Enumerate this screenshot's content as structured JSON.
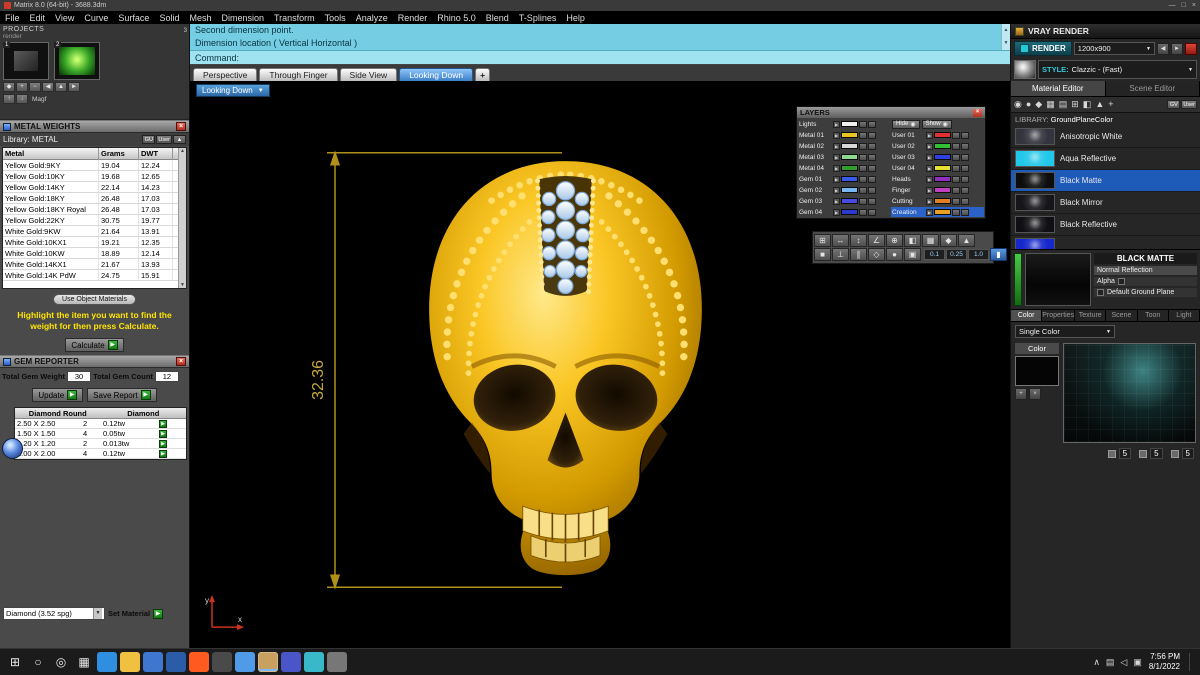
{
  "window": {
    "title": "Matrix 8.0 (64-bit) - 3688.3dm",
    "controls": {
      "minimize": "—",
      "maximize": "□",
      "close": "×"
    },
    "menus": [
      "File",
      "Edit",
      "View",
      "Curve",
      "Surface",
      "Solid",
      "Mesh",
      "Dimension",
      "Transform",
      "Tools",
      "Analyze",
      "Render",
      "Rhino 5.0",
      "Blend",
      "T-Splines",
      "Help"
    ]
  },
  "projects": {
    "label": "PROJECTS",
    "sublabel": "render",
    "thumbs": [
      {
        "num": "1"
      },
      {
        "num": "2"
      }
    ],
    "side_num": "3",
    "toolbar1": [
      "◆",
      "+",
      "−",
      "◀",
      "▲",
      "►"
    ],
    "toolbar2": [
      "↑",
      "↓"
    ],
    "mag_label": "Magf"
  },
  "metal_weights": {
    "title": "METAL WEIGHTS",
    "library_label": "Library:  METAL",
    "lib_buttons": [
      "GU",
      "User",
      "▲"
    ],
    "columns": [
      "Metal",
      "Grams",
      "DWT"
    ],
    "rows": [
      [
        "Yellow Gold:9KY",
        "19.04",
        "12.24"
      ],
      [
        "Yellow Gold:10KY",
        "19.68",
        "12.65"
      ],
      [
        "Yellow Gold:14KY",
        "22.14",
        "14.23"
      ],
      [
        "Yellow Gold:18KY",
        "26.48",
        "17.03"
      ],
      [
        "Yellow Gold:18KY Royal",
        "26.48",
        "17.03"
      ],
      [
        "Yellow Gold:22KY",
        "30.75",
        "19.77"
      ],
      [
        "White Gold:9KW",
        "21.64",
        "13.91"
      ],
      [
        "White Gold:10KX1",
        "19.21",
        "12.35"
      ],
      [
        "White Gold:10KW",
        "18.89",
        "12.14"
      ],
      [
        "White Gold:14KX1",
        "21.67",
        "13.93"
      ],
      [
        "White Gold:14K PdW",
        "24.75",
        "15.91"
      ]
    ],
    "use_object_label": "Use Object Materials",
    "hint": "Highlight the item you want to find the weight for then press Calculate.",
    "calculate_label": "Calculate"
  },
  "gem_reporter": {
    "title": "GEM REPORTER",
    "total_weight_label": "Total Gem Weight",
    "total_weight": "30",
    "total_count_label": "Total Gem Count",
    "total_count": "12",
    "update_label": "Update",
    "save_label": "Save Report",
    "columns": [
      "Diamond Round",
      "Diamond"
    ],
    "rows": [
      [
        "2.50 X 2.50",
        "2",
        "0.12tw"
      ],
      [
        "1.50 X 1.50",
        "4",
        "0.05tw"
      ],
      [
        "1.20 X 1.20",
        "2",
        "0.013tw"
      ],
      [
        "2.00 X 2.00",
        "4",
        "0.12tw"
      ]
    ],
    "material_value": "Diamond   (3.52 spg)",
    "set_material_label": "Set Material"
  },
  "viewport": {
    "history": [
      "Second dimension point.",
      "Dimension location ( Vertical  Horizontal )"
    ],
    "prompt": "Command:",
    "tabs": [
      {
        "label": "Perspective",
        "active": false
      },
      {
        "label": "Through Finger",
        "active": false
      },
      {
        "label": "Side View",
        "active": false
      },
      {
        "label": "Looking Down",
        "active": true
      }
    ],
    "new_tab_label": "+",
    "view_button": "Looking Down",
    "dimension": "32.36"
  },
  "layers": {
    "title": "LAYERS",
    "hide_label": "Hide",
    "show_label": "Show",
    "left": [
      {
        "name": "Lights",
        "color": "#f0f0f0"
      },
      {
        "name": "Metal 01",
        "color": "#e8c520"
      },
      {
        "name": "Metal 02",
        "color": "#d8d8d8"
      },
      {
        "name": "Metal 03",
        "color": "#8ed88e"
      },
      {
        "name": "Metal 04",
        "color": "#2f9e2f"
      },
      {
        "name": "Gem 01",
        "color": "#3a5ae8"
      },
      {
        "name": "Gem 02",
        "color": "#78b8f0"
      },
      {
        "name": "Gem 03",
        "color": "#4a4ae0"
      },
      {
        "name": "Gem 04",
        "color": "#2a3ad0"
      }
    ],
    "right": [
      {
        "name": "User 01",
        "color": "#e03030"
      },
      {
        "name": "User 02",
        "color": "#30c030"
      },
      {
        "name": "User 03",
        "color": "#3040e0"
      },
      {
        "name": "User 04",
        "color": "#e8e030"
      },
      {
        "name": "Heads",
        "color": "#9030c0"
      },
      {
        "name": "Finger",
        "color": "#c040c0"
      },
      {
        "name": "Cutting",
        "color": "#e08020"
      },
      {
        "name": "Creation",
        "color": "#e8a020",
        "active": true
      }
    ]
  },
  "transform_toolbar": {
    "row1": [
      "⊞",
      "↔",
      "↕",
      "∠",
      "⊕",
      "◧",
      "▦",
      "◆",
      "▲"
    ],
    "row2": [
      "■",
      "⊥",
      "∥",
      "◇",
      "●",
      "▣"
    ],
    "snaps": [
      "0.1",
      "0.25",
      "1.0"
    ],
    "pause_label": "▮"
  },
  "vray": {
    "title": "VRAY RENDER",
    "render_label": "RENDER",
    "resolution": "1200x900",
    "res_buttons": [
      "◀",
      "►"
    ],
    "style_label": "STYLE:",
    "style_value": "Clazzic - (Fast)",
    "tabs": [
      {
        "label": "Material Editor",
        "active": true
      },
      {
        "label": "Scene Editor",
        "active": false
      }
    ],
    "tool_icons": [
      "◉",
      "●",
      "◆",
      "▦",
      "▤",
      "⊞",
      "◧",
      "▲",
      "+"
    ],
    "lib_buttons": [
      "GV",
      "User"
    ],
    "library_label": "LIBRARY:",
    "library_value": "GroundPlaneColor",
    "materials": [
      {
        "name": "Anisotropic White",
        "thumb": "#34343e"
      },
      {
        "name": "Aqua Reflective",
        "thumb": "#22c8ea"
      },
      {
        "name": "Black Matte",
        "thumb": "#0d0d0d",
        "active": true
      },
      {
        "name": "Black Mirror",
        "thumb": "#16161a"
      },
      {
        "name": "Black Reflective",
        "thumb": "#101014"
      },
      {
        "name": "",
        "thumb": "#1428cc"
      }
    ],
    "preview": {
      "title": "BLACK MATTE",
      "reflection_label": "Normal Reflection",
      "alpha_label": "Alpha",
      "ground_label": "Default Ground Plane"
    },
    "bottom_tabs": [
      {
        "label": "Color",
        "active": true
      },
      {
        "label": "Properties",
        "active": false
      },
      {
        "label": "Texture",
        "active": false
      },
      {
        "label": "Scene",
        "active": false
      },
      {
        "label": "Toon",
        "active": false
      },
      {
        "label": "Light",
        "active": false
      }
    ],
    "color_mode": "Single Color",
    "color_label": "Color",
    "swatch_buttons": [
      "+",
      "×"
    ],
    "rgb": [
      "5",
      "5",
      "5"
    ]
  },
  "taskbar": {
    "icons": [
      {
        "name": "start",
        "glyph": "⊞",
        "bg": "transparent"
      },
      {
        "name": "search",
        "glyph": "○",
        "bg": "transparent"
      },
      {
        "name": "cortana",
        "glyph": "◎",
        "bg": "transparent"
      },
      {
        "name": "task-view",
        "glyph": "▦",
        "bg": "transparent"
      },
      {
        "name": "edge",
        "glyph": "",
        "bg": "#2f8ee0"
      },
      {
        "name": "file-explorer",
        "glyph": "",
        "bg": "#f0c040"
      },
      {
        "name": "mail",
        "glyph": "",
        "bg": "#3f76d0"
      },
      {
        "name": "outlook",
        "glyph": "",
        "bg": "#2a5ca8"
      },
      {
        "name": "firefox",
        "glyph": "",
        "bg": "#ff5a20"
      },
      {
        "name": "terminal",
        "glyph": "",
        "bg": "#4a4a4a"
      },
      {
        "name": "chrome",
        "glyph": "",
        "bg": "#4f9be8"
      },
      {
        "name": "matrix-active-app",
        "glyph": "",
        "bg": "#c8a060",
        "active": true
      },
      {
        "name": "teams",
        "glyph": "",
        "bg": "#4a55c8"
      },
      {
        "name": "screenshot-tool",
        "glyph": "",
        "bg": "#38b8c8"
      },
      {
        "name": "camera",
        "glyph": "",
        "bg": "#777777"
      }
    ],
    "tray_glyphs": [
      "∧",
      "▤",
      "◁",
      "▣"
    ],
    "time": "7:56 PM",
    "date": "8/1/2022"
  }
}
